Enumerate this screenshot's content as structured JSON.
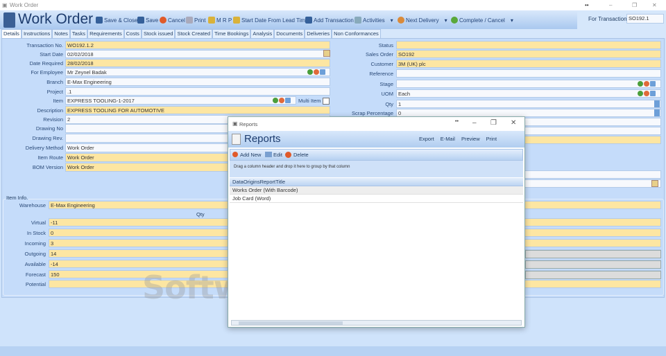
{
  "window": {
    "title": "Work Order",
    "controls": [
      "–",
      "❐",
      "✕"
    ]
  },
  "header": {
    "title": "Work Order",
    "toolbar": [
      "Save & Close",
      "Save",
      "Cancel",
      "Print",
      "M R P",
      "Start Date From Lead Time",
      "Add Transaction",
      "Activities",
      "Next Delivery",
      "Complete / Cancel"
    ],
    "for_transaction_label": "For Transaction",
    "for_transaction_value": "SO192.1"
  },
  "tabs": [
    "Details",
    "Instructions",
    "Notes",
    "Tasks",
    "Requirements",
    "Costs",
    "Stock issued",
    "Stock Created",
    "Time Bookings",
    "Analysis",
    "Documents",
    "Deliveries",
    "Non Conformances"
  ],
  "left_form": [
    {
      "label": "Transaction No.",
      "value": "WO192.1.2"
    },
    {
      "label": "Start Date",
      "value": "02/02/2018"
    },
    {
      "label": "Date Required",
      "value": "28/02/2018"
    },
    {
      "label": "For Employee",
      "value": "Mr Zeynel Badak"
    },
    {
      "label": "Branch",
      "value": "E-Max Engineering"
    },
    {
      "label": "Project",
      "value": ".1"
    },
    {
      "label": "Item",
      "value": "EXPRESS TOOLING-1-2017"
    },
    {
      "label": "Description",
      "value": "EXPRESS TOOLING FOR AUTOMOTIVE"
    },
    {
      "label": "Revision",
      "value": "2"
    },
    {
      "label": "Drawing No",
      "value": ""
    },
    {
      "label": "Drawing Rev.",
      "value": ""
    },
    {
      "label": "Delivery Method",
      "value": "Work Order"
    },
    {
      "label": "Item Route",
      "value": "Work Order"
    },
    {
      "label": "BOM Version",
      "value": "Work Order"
    }
  ],
  "multi_item_label": "Multi Item",
  "right_form": [
    {
      "label": "Status",
      "value": ""
    },
    {
      "label": "Sales Order",
      "value": "SO192"
    },
    {
      "label": "Customer",
      "value": "3M (UK) plc"
    },
    {
      "label": "Reference",
      "value": ""
    },
    {
      "label": "Stage",
      "value": ""
    },
    {
      "label": "UOM",
      "value": "Each"
    },
    {
      "label": "Qty",
      "value": "1"
    },
    {
      "label": "Scrap Percentage",
      "value": "0"
    }
  ],
  "item_info": {
    "title": "Item Info.",
    "warehouse_label": "Warehouse",
    "warehouse": "E-Max Engineering",
    "qty_header": "Qty",
    "rows": [
      {
        "label": "Virtual",
        "value": "-11"
      },
      {
        "label": "In Stock",
        "value": "0"
      },
      {
        "label": "Incoming",
        "value": "3"
      },
      {
        "label": "Outgoing",
        "value": "14"
      },
      {
        "label": "Available",
        "value": "-14"
      },
      {
        "label": "Forecast",
        "value": "150"
      },
      {
        "label": "Potential",
        "value": ""
      }
    ]
  },
  "dialog": {
    "title": "Reports",
    "heading": "Reports",
    "actions": [
      "Export",
      "E-Mail",
      "Preview",
      "Print"
    ],
    "toolbar": [
      "Add New",
      "Edit",
      "Delete"
    ],
    "group_hint": "Drag a column header and drop it here to group by that column",
    "column": "DataOriginsReportTitle",
    "rows": [
      "Works Order (With Barcode)",
      "Job Card (Word)"
    ]
  },
  "watermark": "SoftwareSuggest.com"
}
